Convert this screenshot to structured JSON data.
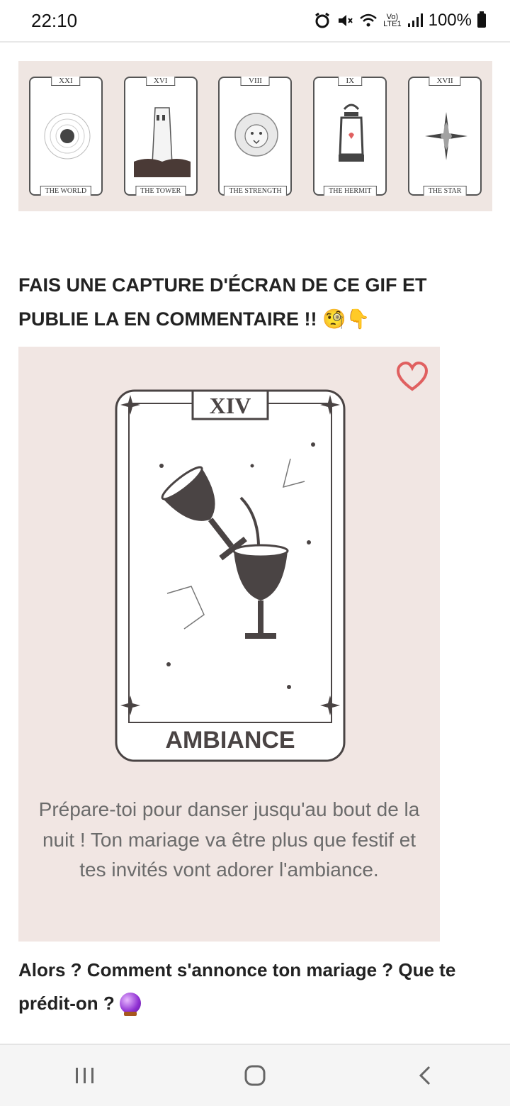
{
  "status_bar": {
    "time": "22:10",
    "network_top": "Vo)",
    "network_bottom": "LTE1",
    "battery": "100%"
  },
  "tarot_cards": [
    {
      "number": "XXI",
      "name": "THE WORLD",
      "icon": "world-icon"
    },
    {
      "number": "XVI",
      "name": "THE TOWER",
      "icon": "tower-icon"
    },
    {
      "number": "VIII",
      "name": "THE STRENGTH",
      "icon": "lion-icon"
    },
    {
      "number": "IX",
      "name": "THE HERMIT",
      "icon": "lantern-icon"
    },
    {
      "number": "XVII",
      "name": "THE STAR",
      "icon": "star-icon"
    }
  ],
  "heading": "FAIS UNE CAPTURE D'ÉCRAN DE CE GIF ET PUBLIE LA EN COMMENTAIRE !! 🧐👇",
  "gif": {
    "card_number": "XIV",
    "card_title": "AMBIANCE",
    "caption": "Prépare-toi pour danser jusqu'au bout de la nuit ! Ton mariage va être plus que festif et tes invités vont adorer l'ambiance.",
    "heart_color": "#e06060"
  },
  "question": "Alors ? Comment s'annonce ton mariage ? Que te prédit-on ?",
  "colors": {
    "panel_bg": "#f1e6e3",
    "ink": "#4a4444"
  }
}
